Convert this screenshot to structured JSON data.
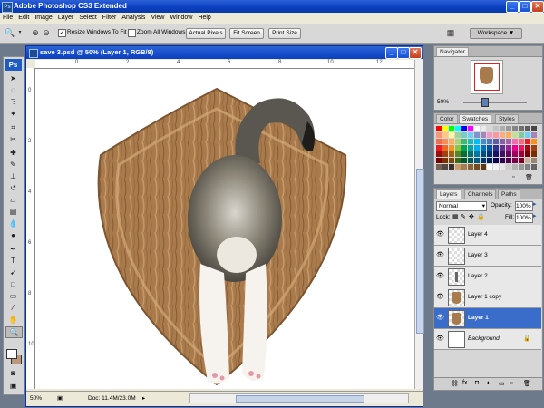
{
  "app": {
    "title": "Adobe Photoshop CS3 Extended",
    "workspace_label": "Workspace",
    "workspace_arrow": "▼"
  },
  "menu": [
    "File",
    "Edit",
    "Image",
    "Layer",
    "Select",
    "Filter",
    "Analysis",
    "View",
    "Window",
    "Help"
  ],
  "options": {
    "resize_windows_label": "Resize Windows To Fit",
    "resize_windows_checked": true,
    "zoom_all_label": "Zoom All Windows",
    "zoom_all_checked": false,
    "actual_pixels": "Actual Pixels",
    "fit_screen": "Fit Screen",
    "print_size": "Print Size"
  },
  "tools": {
    "logo": "Ps"
  },
  "document": {
    "title": "save 3.psd @ 50% (Layer 1, RGB/8)",
    "zoom": "50%",
    "doc_info": "Doc: 11.4M/23.0M",
    "ruler_top": [
      "0",
      "2",
      "4",
      "6",
      "8",
      "10",
      "12",
      "14"
    ],
    "ruler_left": [
      "0",
      "2",
      "4",
      "6",
      "8",
      "10",
      "12"
    ]
  },
  "navigator": {
    "tab": "Navigator",
    "zoom": "50%"
  },
  "swatches": {
    "tabs": [
      "Color",
      "Swatches",
      "Styles"
    ],
    "active_tab": "Swatches",
    "colors": [
      "#ff0000",
      "#ffff00",
      "#00ff00",
      "#00ffff",
      "#0000ff",
      "#ff00ff",
      "#ffffff",
      "#ebebeb",
      "#d6d6d6",
      "#c2c2c2",
      "#adadad",
      "#999999",
      "#858585",
      "#707070",
      "#5c5c5c",
      "#474747",
      "#f7977a",
      "#fdc68a",
      "#fff79a",
      "#a3d39c",
      "#7accc8",
      "#6ecff6",
      "#8393ca",
      "#a187be",
      "#f49ac1",
      "#f6989d",
      "#f9ad81",
      "#fbaf5d",
      "#c4df9b",
      "#82ca9c",
      "#6dcff6",
      "#a186be",
      "#f26c4f",
      "#f68e55",
      "#fbaf5c",
      "#acd372",
      "#3cb878",
      "#1cbbb4",
      "#00bff3",
      "#438ccb",
      "#5674b9",
      "#605ca8",
      "#855fa8",
      "#a763a8",
      "#f06eaa",
      "#f26d7d",
      "#ed1c24",
      "#f7941d",
      "#ed1c24",
      "#f26522",
      "#f7941d",
      "#8dc63f",
      "#00a651",
      "#00a99d",
      "#00aeef",
      "#0072bc",
      "#0054a6",
      "#2e3192",
      "#662d91",
      "#92278f",
      "#ec008c",
      "#ed145b",
      "#9e0b0f",
      "#a0410d",
      "#9e0b0f",
      "#a0410d",
      "#a3620a",
      "#598527",
      "#007236",
      "#00746b",
      "#0076a3",
      "#004b80",
      "#003471",
      "#1b1464",
      "#440e62",
      "#630460",
      "#9e005d",
      "#9e0039",
      "#790000",
      "#7b2e00",
      "#790000",
      "#7b2e00",
      "#7d4900",
      "#406618",
      "#005826",
      "#005952",
      "#005b7f",
      "#003663",
      "#002157",
      "#0d004c",
      "#32004b",
      "#4b0049",
      "#7b0046",
      "#7a0026",
      "#c7b299",
      "#998675",
      "#736357",
      "#534741",
      "#37302d",
      "#c69c6d",
      "#a67c52",
      "#8c6239",
      "#754c24",
      "#603913",
      "#ffffff",
      "#f2f2f2",
      "#e6e6e6",
      "#cccccc",
      "#b3b3b3",
      "#999999",
      "#808080",
      "#666666"
    ]
  },
  "layers": {
    "tabs": [
      "Layers",
      "Channels",
      "Paths"
    ],
    "active_tab": "Layers",
    "blend_mode": "Normal",
    "opacity_label": "Opacity:",
    "opacity": "100%",
    "lock_label": "Lock:",
    "fill_label": "Fill:",
    "fill": "100%",
    "items": [
      {
        "name": "Layer 4",
        "selected": false
      },
      {
        "name": "Layer 3",
        "selected": false
      },
      {
        "name": "Layer 2",
        "selected": false
      },
      {
        "name": "Layer 1 copy",
        "selected": false
      },
      {
        "name": "Layer 1",
        "selected": true
      },
      {
        "name": "Background",
        "selected": false
      }
    ],
    "footer_icons": [
      "link-icon",
      "fx-icon",
      "mask-icon",
      "adjustment-icon",
      "group-icon",
      "new-layer-icon",
      "trash-icon"
    ]
  }
}
